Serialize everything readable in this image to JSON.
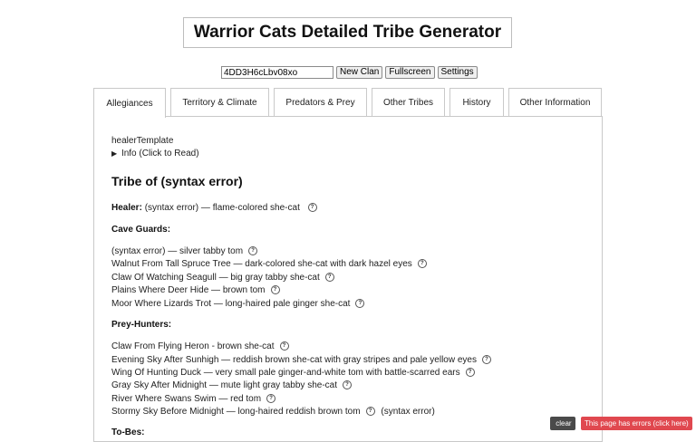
{
  "header": {
    "title": "Warrior Cats Detailed Tribe Generator"
  },
  "controls": {
    "seed_value": "4DD3H6cLbv08xo",
    "new_clan_label": "New Clan",
    "fullscreen_label": "Fullscreen",
    "settings_label": "Settings"
  },
  "tabs": [
    {
      "label": "Allegiances"
    },
    {
      "label": "Territory & Climate"
    },
    {
      "label": "Predators & Prey"
    },
    {
      "label": "Other Tribes"
    },
    {
      "label": "History"
    },
    {
      "label": "Other Information"
    }
  ],
  "content": {
    "template_name": "healerTemplate",
    "info_label": "Info (Click to Read)",
    "tribe_title": "Tribe of (syntax error)",
    "healer_label": "Healer:",
    "healer_text": "(syntax error) — flame-colored she-cat",
    "cave_guards_label": "Cave Guards:",
    "cave_guards": [
      "(syntax error) — silver tabby tom",
      "Walnut From Tall Spruce Tree — dark-colored she-cat with dark hazel eyes",
      "Claw Of Watching Seagull — big gray tabby she-cat",
      "Plains Where Deer Hide — brown tom",
      "Moor Where Lizards Trot — long-haired pale ginger she-cat"
    ],
    "prey_hunters_label": "Prey-Hunters:",
    "prey_hunters": [
      "Claw From Flying Heron - brown she-cat",
      "Evening Sky After Sunhigh — reddish brown she-cat with gray stripes and pale yellow eyes",
      "Wing Of Hunting Duck — very small pale ginger-and-white tom with battle-scarred ears",
      "Gray Sky After Midnight — mute light gray tabby she-cat",
      "River Where Swans Swim — red tom",
      "Stormy Sky Before Midnight — long-haired reddish brown tom"
    ],
    "trailing_error": "(syntax error)",
    "to_bes_label": "To-Bes:"
  },
  "footer": {
    "clear_label": " clear",
    "error_label": "This page has errors (click here)"
  },
  "icons": {
    "help": "question-circle-icon",
    "disclosure": "triangle-right-icon"
  },
  "colors": {
    "error_badge": "#e0484f",
    "clear_badge": "#4a4a4a",
    "border": "#c9c9c9"
  }
}
